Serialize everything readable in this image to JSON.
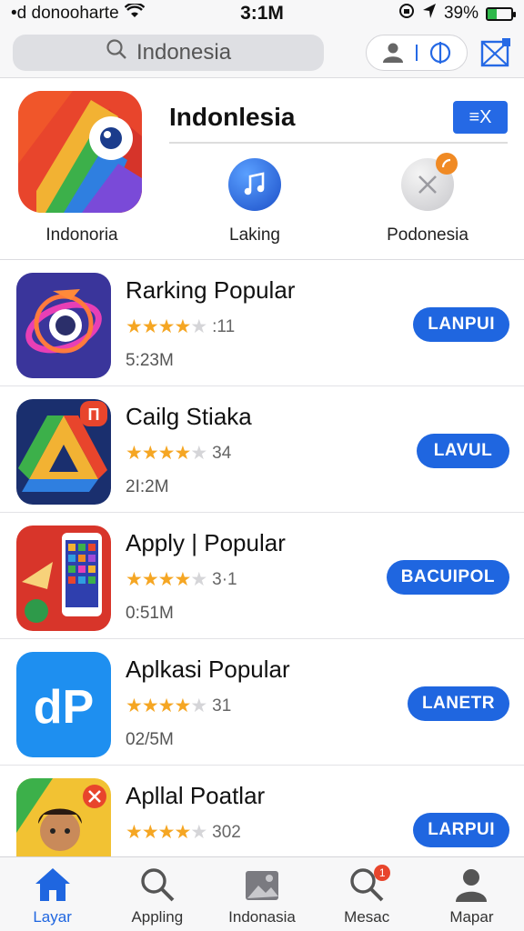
{
  "status_bar": {
    "carrier": "•d donooharte",
    "time": "3:1M",
    "battery": "39%",
    "battery_level": 0.39
  },
  "search": {
    "placeholder": "Indonesia"
  },
  "featured": {
    "title": "Indonlesia",
    "close_label": "≡X",
    "main_app_label": "Indonoria",
    "sub_apps": [
      {
        "label": "Laking",
        "icon": "music-note-icon"
      },
      {
        "label": "Podonesia",
        "icon": "x-icon",
        "badge": true
      }
    ]
  },
  "apps": [
    {
      "name": "Rarking Popular",
      "rating_value": 4,
      "rating_count": ":11",
      "size": "5:23M",
      "button": "LANPUI"
    },
    {
      "name": "Cailg Stiaka",
      "rating_value": 4,
      "rating_count": "34",
      "size": "2I:2M",
      "button": "LAVUL"
    },
    {
      "name": "Apply | Popular",
      "rating_value": 4,
      "rating_count": "3·1",
      "size": "0:51M",
      "button": "BACUIPOL"
    },
    {
      "name": "Aplkasi Popular",
      "rating_value": 4,
      "rating_count": "31",
      "size": "02/5M",
      "button": "LANETR"
    },
    {
      "name": "Apllal Poatlar",
      "rating_value": 4,
      "rating_count": "302",
      "size": "",
      "button": "LARPUI"
    }
  ],
  "tab_bar": {
    "tabs": [
      {
        "label": "Layar",
        "icon": "home-icon",
        "active": true
      },
      {
        "label": "Appling",
        "icon": "search-icon",
        "active": false
      },
      {
        "label": "Indonasia",
        "icon": "image-icon",
        "active": false
      },
      {
        "label": "Mesac",
        "icon": "search-badge-icon",
        "active": false,
        "badge": "1"
      },
      {
        "label": "Mapar",
        "icon": "person-icon",
        "active": false
      }
    ]
  },
  "colors": {
    "accent": "#1f66e0",
    "star": "#f5a623",
    "battery": "#2fb84b"
  }
}
